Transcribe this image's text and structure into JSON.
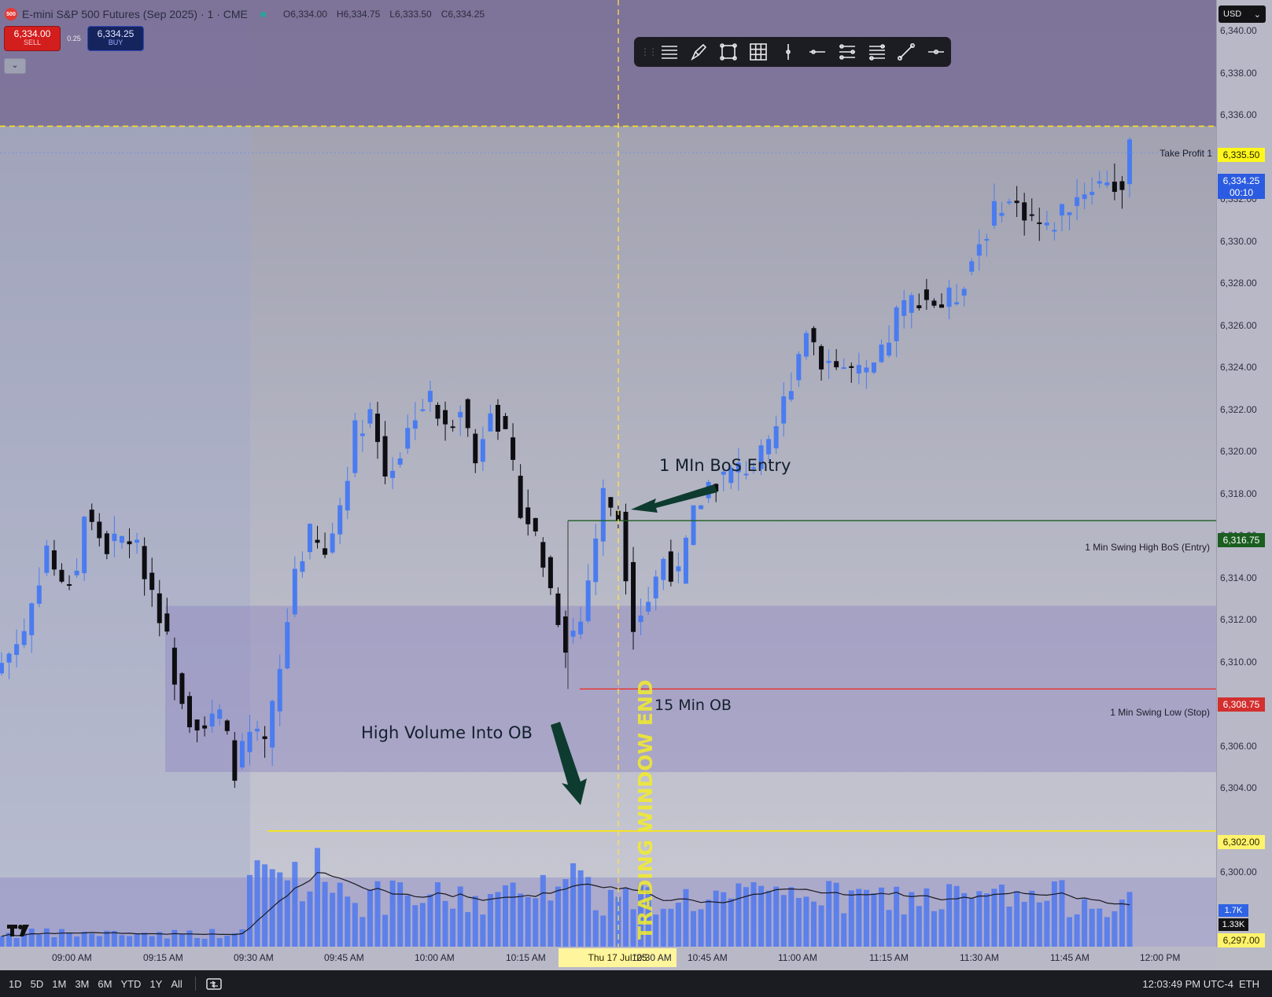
{
  "header": {
    "logo_badge": "500",
    "title": "E-mini S&P 500 Futures (Sep 2025) · 1 · CME",
    "open": "O6,334.00",
    "high": "H6,334.75",
    "low": "L6,333.50",
    "close": "C6,334.25",
    "status_color": "#26a69a"
  },
  "trade_panel": {
    "sell_price": "6,334.00",
    "sell_label": "SELL",
    "spread": "0.25",
    "buy_price": "6,334.25",
    "buy_label": "BUY",
    "collapse_icon": "chevron-down-icon"
  },
  "drawing_toolbar": {
    "tools": [
      "lines-icon",
      "brush-icon",
      "rectangle-icon",
      "grid-icon",
      "vertical-line-icon",
      "horizontal-line-icon",
      "parallel-channel-icon",
      "fib-retracement-icon",
      "trend-line-icon",
      "horizontal-ray-icon"
    ]
  },
  "currency": {
    "label": "USD"
  },
  "price_axis": {
    "ticks": [
      "6,340.00",
      "6,338.00",
      "6,336.00",
      "6,332.00",
      "6,330.00",
      "6,328.00",
      "6,326.00",
      "6,324.00",
      "6,322.00",
      "6,320.00",
      "6,318.00",
      "6,316.00",
      "6,314.00",
      "6,312.00",
      "6,310.00",
      "6,308.00",
      "6,306.00",
      "6,304.00",
      "6,300.00"
    ],
    "take_profit": "6,335.50",
    "current_price": "6,334.25",
    "countdown": "00:10",
    "entry": "6,316.75",
    "stop": "6,308.75",
    "yellow_level": "6,302.00",
    "bottom_level": "6,297.00"
  },
  "levels": {
    "take_profit_label": "Take Profit 1",
    "entry_label": "1 Min Swing High BoS (Entry)",
    "stop_label": "1 Min Swing Low (Stop)"
  },
  "annotations": {
    "bos": "1 MIn BoS Entry",
    "ob": "15 Min OB",
    "volume": "High Volume Into OB",
    "window": "TRADING WINDOW END"
  },
  "volume": {
    "value": "1.7K",
    "ma": "1.33K"
  },
  "time_axis": {
    "ticks": [
      "09:00 AM",
      "09:15 AM",
      "09:30 AM",
      "09:45 AM",
      "10:00 AM",
      "10:15 AM",
      "10:30 AM",
      "10:45 AM",
      "11:00 AM",
      "11:15 AM",
      "11:30 AM",
      "11:45 AM",
      "12:00 PM"
    ],
    "cursor": "Thu 17 Jul '25"
  },
  "bottom_bar": {
    "ranges": [
      "1D",
      "5D",
      "1M",
      "3M",
      "6M",
      "YTD",
      "1Y",
      "All"
    ],
    "clock": "12:03:49 PM UTC-4",
    "session": "ETH"
  },
  "colors": {
    "bull": "#4a7cf0",
    "bear": "#0d0d12",
    "entry": "#1b5e20",
    "stop": "#e53935",
    "take_profit": "#ffe812",
    "zone": "#8f86c1"
  },
  "chart_data": {
    "type": "candlestick",
    "symbol": "E-mini S&P 500 Futures (Sep 2025)",
    "interval": "1",
    "ylim": [
      6296.5,
      6341.5
    ],
    "x": [
      "09:00 AM",
      "09:15 AM",
      "09:30 AM",
      "09:45 AM",
      "10:00 AM",
      "10:15 AM",
      "10:30 AM",
      "10:45 AM",
      "11:00 AM",
      "11:15 AM",
      "11:30 AM",
      "11:45 AM",
      "12:00 PM"
    ],
    "close_path": [
      [
        0,
        6310.0
      ],
      [
        3,
        6311.5
      ],
      [
        6,
        6315.5
      ],
      [
        8,
        6313.5
      ],
      [
        10,
        6314.5
      ],
      [
        11,
        6317.0
      ],
      [
        14,
        6315.5
      ],
      [
        17,
        6316.0
      ],
      [
        19,
        6314.5
      ],
      [
        21,
        6312.5
      ],
      [
        23,
        6309.5
      ],
      [
        25,
        6307.5
      ],
      [
        27,
        6307.0
      ],
      [
        29,
        6307.5
      ],
      [
        31,
        6305.0
      ],
      [
        33,
        6306.5
      ],
      [
        35,
        6306.0
      ],
      [
        37,
        6309.5
      ],
      [
        39,
        6314.5
      ],
      [
        41,
        6316.0
      ],
      [
        43,
        6315.0
      ],
      [
        45,
        6317.5
      ],
      [
        47,
        6321.0
      ],
      [
        49,
        6322.0
      ],
      [
        51,
        6319.0
      ],
      [
        53,
        6320.0
      ],
      [
        55,
        6322.0
      ],
      [
        57,
        6322.5
      ],
      [
        59,
        6321.0
      ],
      [
        61,
        6322.5
      ],
      [
        63,
        6319.5
      ],
      [
        65,
        6322.5
      ],
      [
        67,
        6320.5
      ],
      [
        69,
        6317.5
      ],
      [
        71,
        6316.0
      ],
      [
        73,
        6313.5
      ],
      [
        75,
        6311.0
      ],
      [
        77,
        6312.0
      ],
      [
        79,
        6316.0
      ],
      [
        80,
        6318.0
      ],
      [
        82,
        6317.0
      ],
      [
        84,
        6312.0
      ],
      [
        86,
        6313.0
      ],
      [
        88,
        6315.0
      ],
      [
        90,
        6314.0
      ],
      [
        92,
        6317.0
      ],
      [
        94,
        6318.5
      ],
      [
        97,
        6319.0
      ],
      [
        100,
        6319.5
      ],
      [
        102,
        6320.0
      ],
      [
        105,
        6323.5
      ],
      [
        107,
        6326.0
      ],
      [
        109,
        6324.5
      ],
      [
        112,
        6324.0
      ],
      [
        115,
        6323.5
      ],
      [
        117,
        6324.5
      ],
      [
        119,
        6326.5
      ],
      [
        122,
        6327.5
      ],
      [
        125,
        6327.0
      ],
      [
        127,
        6327.5
      ],
      [
        130,
        6330.0
      ],
      [
        133,
        6332.0
      ],
      [
        136,
        6331.5
      ],
      [
        139,
        6330.5
      ],
      [
        141,
        6331.5
      ],
      [
        144,
        6332.5
      ],
      [
        147,
        6333.0
      ],
      [
        149,
        6332.5
      ],
      [
        150,
        6334.25
      ]
    ],
    "levels": [
      {
        "name": "Take Profit 1",
        "value": 6335.5
      },
      {
        "name": "1 Min Swing High BoS (Entry)",
        "value": 6316.75
      },
      {
        "name": "1 Min Swing Low (Stop)",
        "value": 6308.75
      },
      {
        "name": "yellow line",
        "value": 6302.0
      }
    ],
    "zones": [
      {
        "name": "upper zone",
        "from": 6335.5,
        "to": 6341.5
      },
      {
        "name": "15 Min OB",
        "from": 6304.8,
        "to": 6312.7
      }
    ]
  }
}
